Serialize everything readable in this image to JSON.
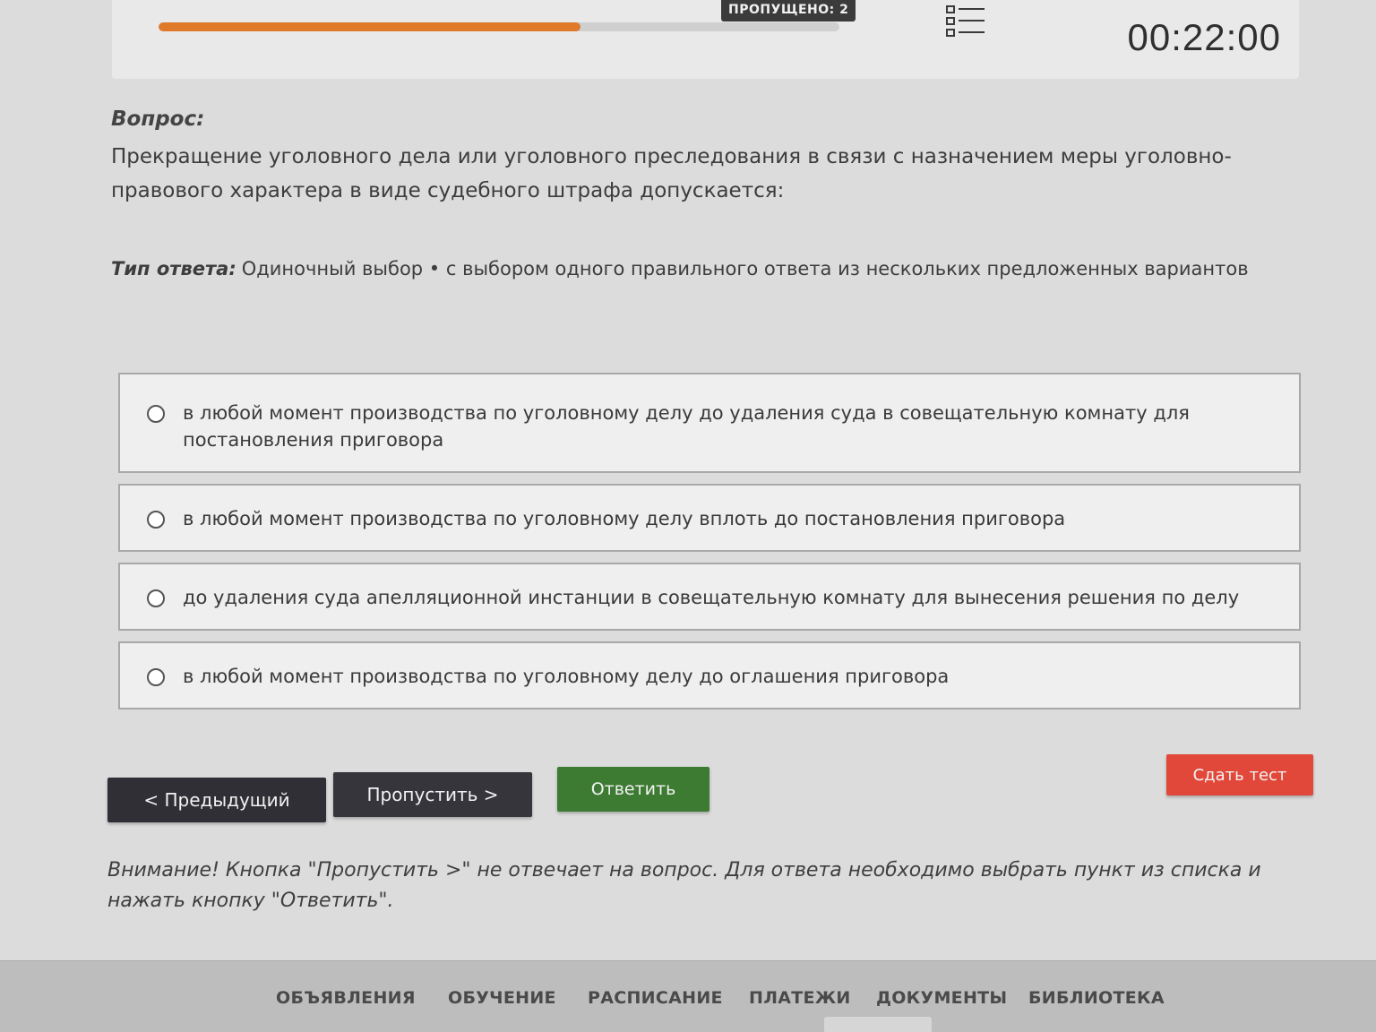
{
  "header": {
    "skipped_label": "ПРОПУЩЕНО: 2",
    "progress": 0.62,
    "timer": "00:22:00",
    "icons": [
      "list-icon"
    ]
  },
  "question": {
    "label": "Вопрос:",
    "text": "Прекращение уголовного дела или уголовного преследования в связи с назначением меры уголовно-правового характера в виде судебного штрафа допускается:"
  },
  "answer_type": {
    "label": "Тип ответа:",
    "value": "Одиночный выбор • с выбором одного правильного ответа из нескольких предложенных вариантов"
  },
  "options": [
    "в любой момент производства по уголовному делу до удаления суда в совещательную комнату для постановления приговора",
    "в любой момент производства по уголовному делу вплоть до постановления приговора",
    "до удаления суда апелляционной инстанции в совещательную комнату для вынесения решения по делу",
    "в любой момент производства по уголовному делу до оглашения приговора"
  ],
  "buttons": {
    "prev": "< Предыдущий",
    "skip": "Пропустить >",
    "answer": "Ответить",
    "submit": "Сдать тест"
  },
  "notice": "Внимание! Кнопка \"Пропустить >\" не отвечает на вопрос. Для ответа необходимо выбрать пункт из списка и нажать кнопку \"Ответить\".",
  "nav": [
    "ОБЪЯВЛЕНИЯ",
    "ОБУЧЕНИЕ",
    "РАСПИСАНИЕ",
    "ПЛАТЕЖИ",
    "ДОКУМЕНТЫ",
    "БИБЛИОТЕКА"
  ],
  "colors": {
    "progress": "#e07a2b",
    "answer_button": "#3d7b33",
    "submit_button": "#e2483a",
    "dark_button": "#2f2f35"
  }
}
